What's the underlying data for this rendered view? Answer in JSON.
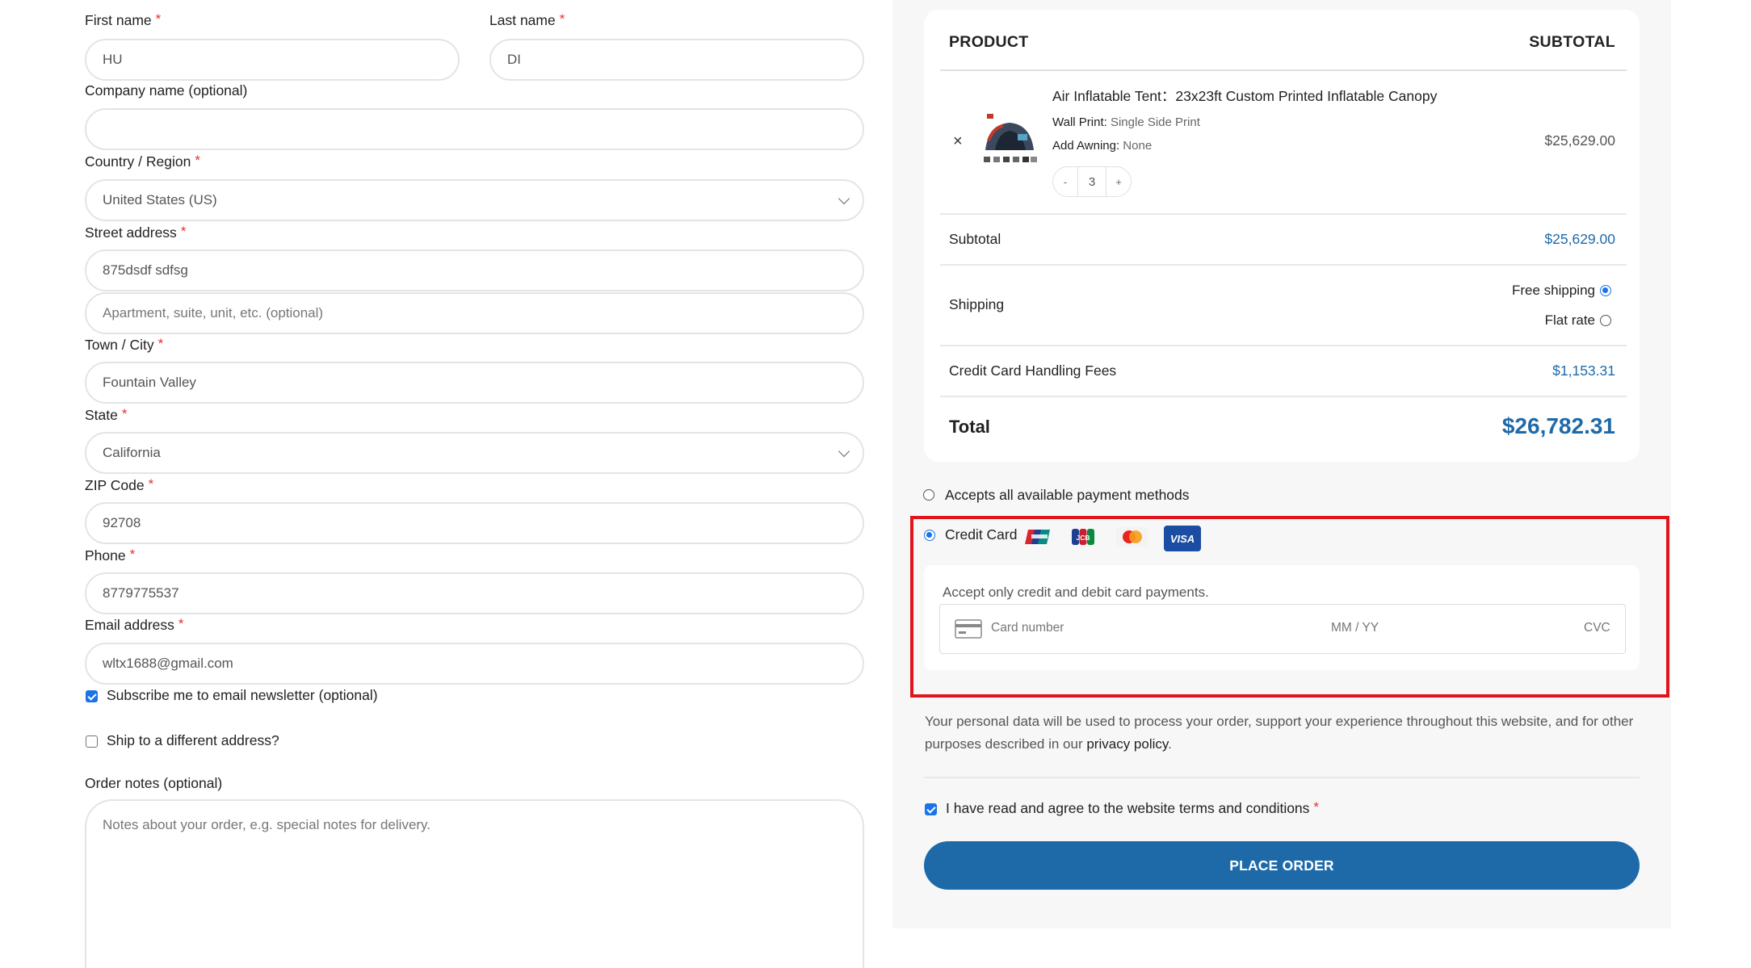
{
  "billing": {
    "first_name": {
      "label": "First name",
      "value": "HU"
    },
    "last_name": {
      "label": "Last name",
      "value": "DI"
    },
    "company": {
      "label": "Company name (optional)",
      "value": ""
    },
    "country": {
      "label": "Country / Region",
      "value": "United States (US)"
    },
    "street": {
      "label": "Street address",
      "value": "875dsdf sdfsg",
      "placeholder2": "Apartment, suite, unit, etc. (optional)"
    },
    "city": {
      "label": "Town / City",
      "value": "Fountain Valley"
    },
    "state": {
      "label": "State",
      "value": "California"
    },
    "zip": {
      "label": "ZIP Code",
      "value": "92708"
    },
    "phone": {
      "label": "Phone",
      "value": "8779775537"
    },
    "email": {
      "label": "Email address",
      "value": "wltx1688@gmail.com"
    },
    "required_mark": "*",
    "subscribe": {
      "label": "Subscribe me to email newsletter (optional)",
      "checked": true
    },
    "ship_different": {
      "label": "Ship to a different address?",
      "checked": false
    },
    "order_notes": {
      "label": "Order notes (optional)",
      "placeholder": "Notes about your order, e.g. special notes for delivery."
    }
  },
  "order": {
    "col_product": "PRODUCT",
    "col_subtotal": "SUBTOTAL",
    "item": {
      "remove_icon": "×",
      "title": "Air Inflatable Tent：23x23ft Custom Printed Inflatable Canopy",
      "wall_print_label": "Wall Print:",
      "wall_print_value": "Single Side Print",
      "awning_label": "Add Awning:",
      "awning_value": "None",
      "qty_minus": "-",
      "qty": "3",
      "qty_plus": "+",
      "price": "$25,629.00"
    },
    "subtotal_label": "Subtotal",
    "subtotal_value": "$25,629.00",
    "shipping_label": "Shipping",
    "shipping_options": [
      {
        "label": "Free shipping",
        "selected": true
      },
      {
        "label": "Flat rate",
        "selected": false
      }
    ],
    "fees_label": "Credit Card Handling Fees",
    "fees_value": "$1,153.31",
    "total_label": "Total",
    "total_value": "$26,782.31"
  },
  "payment": {
    "all_methods_label": "Accepts all available payment methods",
    "credit_card_label": "Credit Card",
    "card_logos": [
      "unionpay",
      "jcb",
      "mastercard",
      "visa"
    ],
    "visa_text": "VISA",
    "jcb_text": "JCB",
    "description": "Accept only credit and debit card payments.",
    "card_number_placeholder": "Card number",
    "expiry_placeholder": "MM / YY",
    "cvc_placeholder": "CVC"
  },
  "privacy": {
    "text_before": "Your personal data will be used to process your order, support your experience throughout this website, and for other purposes described in our ",
    "link": "privacy policy",
    "text_after": "."
  },
  "terms": {
    "label": "I have read and agree to the website terms and conditions",
    "checked": true
  },
  "place_order": "PLACE ORDER",
  "colors": {
    "accent": "#1e6aa8",
    "required": "#e0332e",
    "highlight_border": "#e0141c"
  }
}
